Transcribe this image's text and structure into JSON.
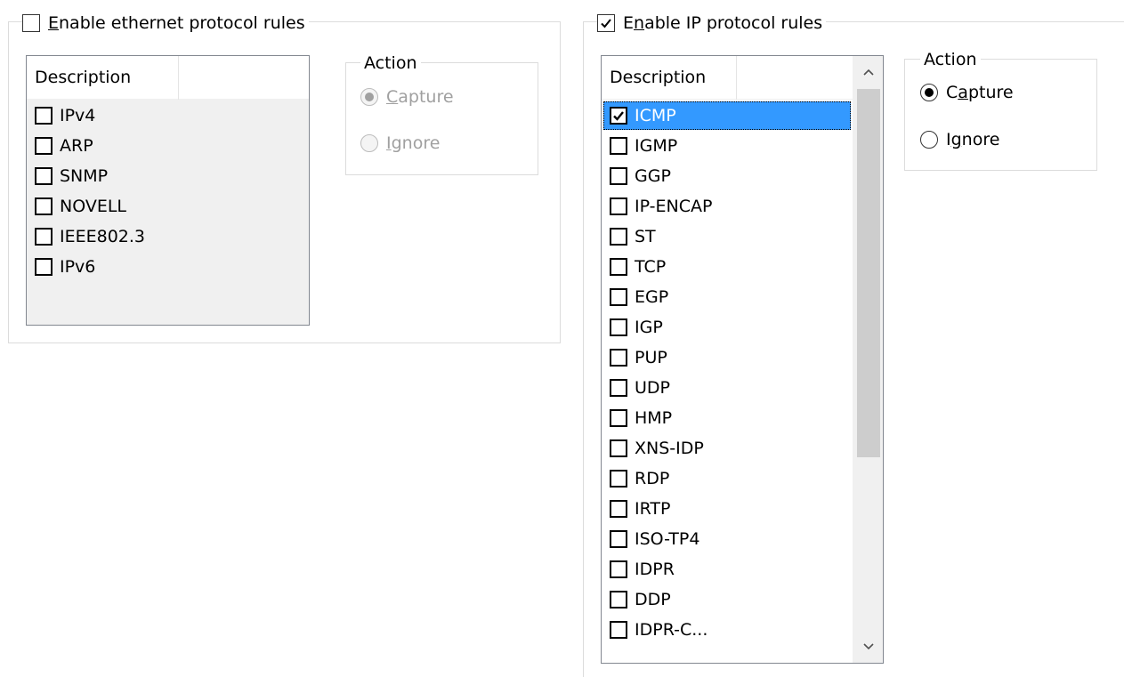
{
  "ethernet": {
    "enable_label_mnemonic": "E",
    "enable_label_rest": "nable ethernet protocol rules",
    "enabled": false,
    "list_header": "Description",
    "items": [
      {
        "label": "IPv4",
        "checked": false
      },
      {
        "label": "ARP",
        "checked": false
      },
      {
        "label": "SNMP",
        "checked": false
      },
      {
        "label": "NOVELL",
        "checked": false
      },
      {
        "label": "IEEE802.3",
        "checked": false
      },
      {
        "label": "IPv6",
        "checked": false
      }
    ],
    "action": {
      "title": "Action",
      "capture_mnemonic": "C",
      "capture_rest": "apture",
      "ignore_mnemonic": "I",
      "ignore_rest": "gnore",
      "selected": "capture",
      "disabled": true
    }
  },
  "ip": {
    "enable_label_pre": "E",
    "enable_label_mnemonic": "n",
    "enable_label_rest": "able IP protocol rules",
    "enabled": true,
    "list_header": "Description",
    "items": [
      {
        "label": "ICMP",
        "checked": true,
        "selected": true
      },
      {
        "label": "IGMP",
        "checked": false
      },
      {
        "label": "GGP",
        "checked": false
      },
      {
        "label": "IP-ENCAP",
        "checked": false
      },
      {
        "label": "ST",
        "checked": false
      },
      {
        "label": "TCP",
        "checked": false
      },
      {
        "label": "EGP",
        "checked": false
      },
      {
        "label": "IGP",
        "checked": false
      },
      {
        "label": "PUP",
        "checked": false
      },
      {
        "label": "UDP",
        "checked": false
      },
      {
        "label": "HMP",
        "checked": false
      },
      {
        "label": "XNS-IDP",
        "checked": false
      },
      {
        "label": "RDP",
        "checked": false
      },
      {
        "label": "IRTP",
        "checked": false
      },
      {
        "label": "ISO-TP4",
        "checked": false
      },
      {
        "label": "IDPR",
        "checked": false
      },
      {
        "label": "DDP",
        "checked": false
      },
      {
        "label": "IDPR-C...",
        "checked": false
      }
    ],
    "action": {
      "title": "Action",
      "capture_pre": "C",
      "capture_mnemonic": "a",
      "capture_rest": "pture",
      "ignore_pre": "I",
      "ignore_mnemonic": "g",
      "ignore_rest": "nore",
      "selected": "capture",
      "disabled": false
    }
  },
  "icons": {
    "checkmark": "checkmark-icon",
    "scroll_up": "chevron-up-icon",
    "scroll_down": "chevron-down-icon"
  },
  "colors": {
    "selection": "#3399ff",
    "groupbox_border": "#dcdcdc",
    "list_border": "#828790",
    "disabled_text": "#a0a0a0",
    "scroll_thumb": "#cdcdcd"
  }
}
